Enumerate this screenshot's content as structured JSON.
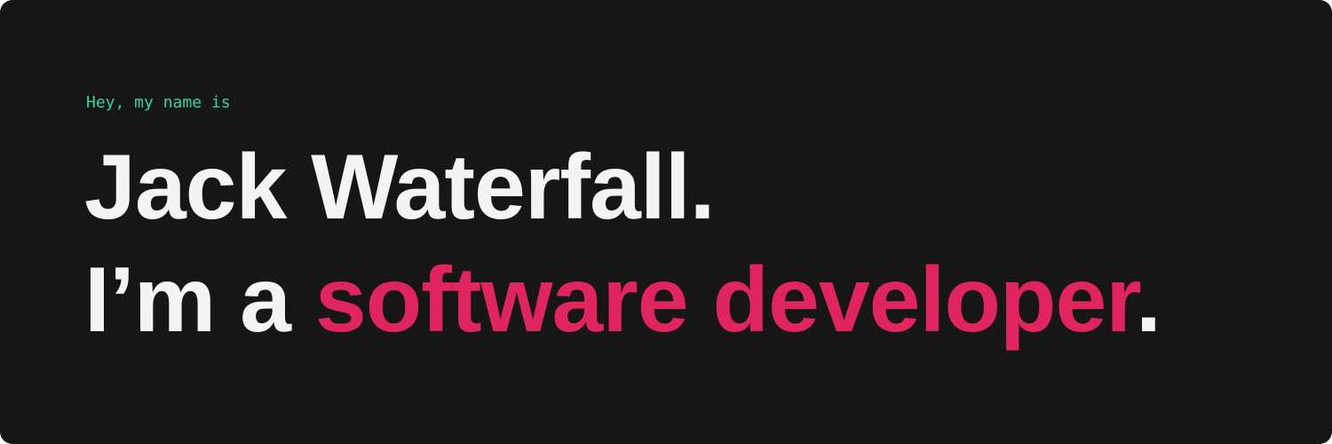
{
  "hero": {
    "greeting": "Hey, my name is",
    "name_line": "Jack Waterfall.",
    "role_prefix": "I’m a ",
    "role_highlight": "software developer",
    "role_suffix": "."
  },
  "colors": {
    "background": "#161616",
    "greeting": "#2fd6a0",
    "text": "#f4f4f4",
    "highlight": "#e0245e"
  }
}
